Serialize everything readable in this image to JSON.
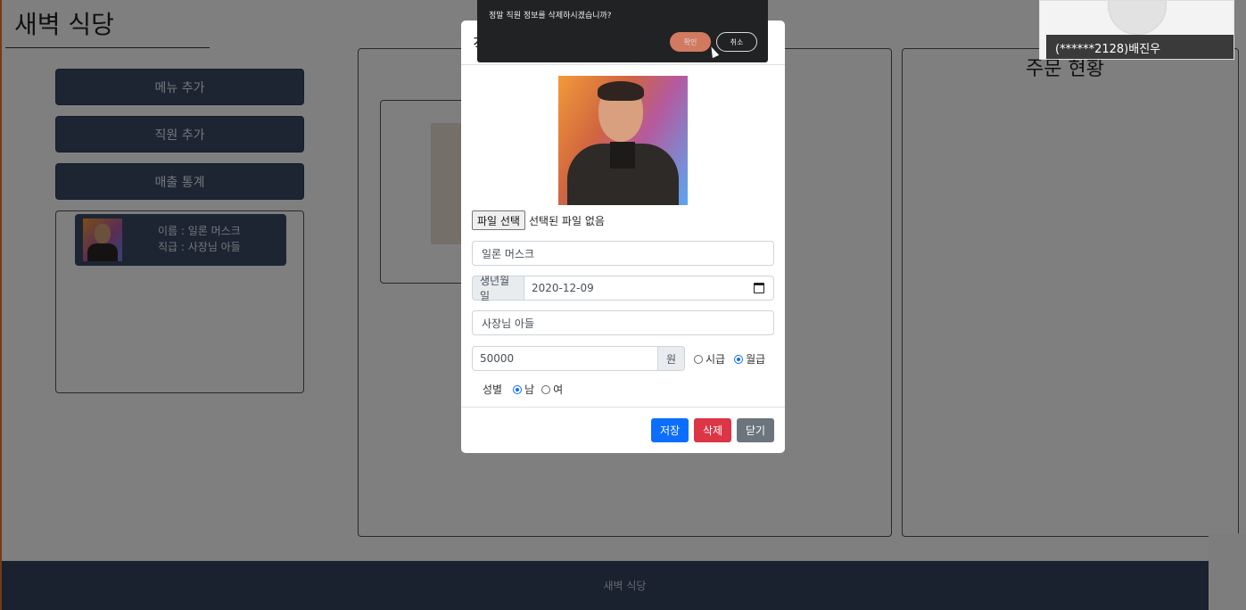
{
  "app": {
    "title": "새벽 식당",
    "footer_text": "새벽 식당"
  },
  "sidebar": {
    "buttons": [
      {
        "label": "메뉴 추가"
      },
      {
        "label": "직원 추가"
      },
      {
        "label": "매출 통계"
      }
    ],
    "staff_card": {
      "name_line": "이름 : 일론 머스크",
      "rank_line": "직급 : 사장님 아들"
    }
  },
  "right_panel": {
    "title": "주문 현황"
  },
  "modal": {
    "header_title": "직",
    "file_button": "파일 선택",
    "file_status": "선택된 파일 없음",
    "name_value": "일론 머스크",
    "birth_label": "생년월일",
    "birth_value": "2020-12-09",
    "rank_value": "사장님 아들",
    "pay_value": "50000",
    "pay_unit": "원",
    "pay_type_hourly": "시급",
    "pay_type_monthly": "월급",
    "pay_type_selected": "월급",
    "gender_label": "성별",
    "gender_male": "남",
    "gender_female": "여",
    "gender_selected": "남",
    "save_label": "저장",
    "delete_label": "삭제",
    "close_label": "닫기",
    "colors": {
      "save": "#0d6efd",
      "delete": "#dc3545",
      "close": "#6c757d"
    }
  },
  "confirm_dialog": {
    "message": "정말 직원 정보를 삭제하시겠습니까?",
    "ok_label": "확인",
    "cancel_label": "취소"
  },
  "video_call": {
    "participant_label": "(******2128)배진우"
  }
}
